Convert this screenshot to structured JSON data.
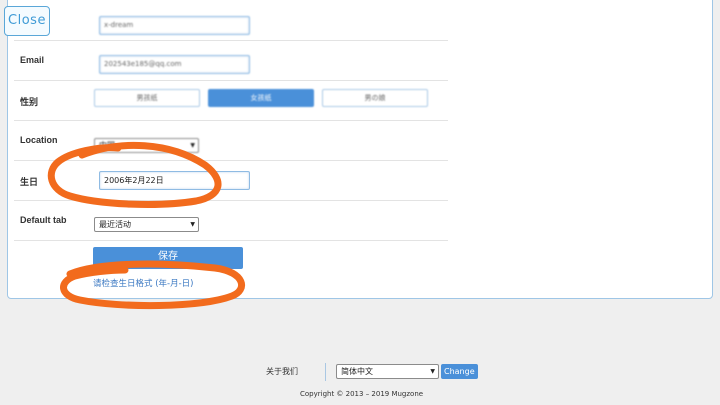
{
  "overlay": {
    "close_label": "Close"
  },
  "form": {
    "nickname_value": "x-dream",
    "email_label": "Email",
    "email_value": "202543e185@qq.com",
    "gender_label": "性别",
    "gender_options": [
      "男孩纸",
      "女孩纸",
      "男の娘"
    ],
    "gender_selected_index": 1,
    "location_label": "Location",
    "location_value": "中国",
    "birthday_label": "生日",
    "birthday_value": "2006年2月22日",
    "default_tab_label": "Default tab",
    "default_tab_value": "最近活动",
    "save_label": "保存",
    "error_message": "请检查生日格式 (年-月-日)"
  },
  "footer": {
    "about_label": "关于我们",
    "language_value": "简体中文",
    "change_label": "Change",
    "copyright": "Copyright © 2013 – 2019 Mugzone"
  },
  "colors": {
    "accent": "#4a90d9",
    "annotation": "#f26b1d",
    "error_text": "#3b78c2"
  }
}
